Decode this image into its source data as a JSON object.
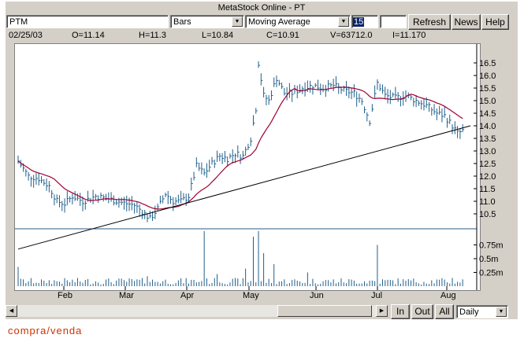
{
  "window": {
    "title": "MetaStock Online - PT"
  },
  "toolbar": {
    "symbol": "PTM",
    "chart_style": "Bars",
    "indicator": "Moving Average",
    "period": "15",
    "extra_value": "",
    "refresh_label": "Refresh",
    "news_label": "News",
    "help_label": "Help"
  },
  "stats": {
    "date": "02/25/03",
    "open": "O=11.14",
    "high": "H=11.3",
    "low": "L=10.84",
    "close": "C=10.91",
    "volume": "V=63712.0",
    "indicator": "I=11.170"
  },
  "bottom": {
    "in_label": "In",
    "out_label": "Out",
    "all_label": "All",
    "interval": "Daily"
  },
  "footer": {
    "text": "compra/venda"
  },
  "colors": {
    "bars": "#1f5f8b",
    "moving_average": "#a00030",
    "trendline": "#000000",
    "volume": "#1f5f8b"
  },
  "chart_data": {
    "type": "bar",
    "title": "",
    "price_axis": {
      "ticks": [
        "16.5",
        "16.0",
        "15.5",
        "15.0",
        "14.5",
        "14.0",
        "13.5",
        "13.0",
        "12.5",
        "12.0",
        "11.5",
        "11.0",
        "10.5"
      ],
      "range": [
        10.0,
        17.0
      ]
    },
    "volume_axis": {
      "ticks": [
        "0.75m",
        "0.5m",
        "0.25m"
      ],
      "range": [
        0,
        1.0
      ]
    },
    "x_labels": [
      "Feb",
      "Mar",
      "Apr",
      "May",
      "Jun",
      "Jul",
      "Aug"
    ],
    "price_path": [
      {
        "t": 0,
        "v": 12.6
      },
      {
        "t": 4,
        "v": 12.0
      },
      {
        "t": 8,
        "v": 11.9
      },
      {
        "t": 12,
        "v": 11.6
      },
      {
        "t": 15,
        "v": 11.0
      },
      {
        "t": 18,
        "v": 10.9
      },
      {
        "t": 21,
        "v": 11.2
      },
      {
        "t": 25,
        "v": 11.0
      },
      {
        "t": 30,
        "v": 11.2
      },
      {
        "t": 35,
        "v": 11.1
      },
      {
        "t": 40,
        "v": 10.95
      },
      {
        "t": 45,
        "v": 10.85
      },
      {
        "t": 48,
        "v": 10.6
      },
      {
        "t": 51,
        "v": 10.3
      },
      {
        "t": 54,
        "v": 10.7
      },
      {
        "t": 57,
        "v": 11.3
      },
      {
        "t": 60,
        "v": 11.0
      },
      {
        "t": 63,
        "v": 11.0
      },
      {
        "t": 66,
        "v": 11.2
      },
      {
        "t": 69,
        "v": 12.4
      },
      {
        "t": 72,
        "v": 12.1
      },
      {
        "t": 75,
        "v": 12.5
      },
      {
        "t": 78,
        "v": 12.8
      },
      {
        "t": 81,
        "v": 12.7
      },
      {
        "t": 84,
        "v": 12.9
      },
      {
        "t": 87,
        "v": 12.8
      },
      {
        "t": 90,
        "v": 13.5
      },
      {
        "t": 92,
        "v": 14.7
      },
      {
        "t": 93,
        "v": 16.5
      },
      {
        "t": 95,
        "v": 15.2
      },
      {
        "t": 97,
        "v": 15.0
      },
      {
        "t": 100,
        "v": 15.9
      },
      {
        "t": 103,
        "v": 15.3
      },
      {
        "t": 106,
        "v": 15.3
      },
      {
        "t": 110,
        "v": 15.5
      },
      {
        "t": 114,
        "v": 15.6
      },
      {
        "t": 118,
        "v": 15.5
      },
      {
        "t": 122,
        "v": 15.6
      },
      {
        "t": 126,
        "v": 15.4
      },
      {
        "t": 130,
        "v": 15.3
      },
      {
        "t": 133,
        "v": 15.0
      },
      {
        "t": 136,
        "v": 14.2
      },
      {
        "t": 139,
        "v": 15.7
      },
      {
        "t": 142,
        "v": 15.2
      },
      {
        "t": 146,
        "v": 15.1
      },
      {
        "t": 150,
        "v": 15.2
      },
      {
        "t": 154,
        "v": 15.0
      },
      {
        "t": 158,
        "v": 14.8
      },
      {
        "t": 162,
        "v": 14.5
      },
      {
        "t": 165,
        "v": 14.4
      },
      {
        "t": 168,
        "v": 14.0
      },
      {
        "t": 170,
        "v": 13.7
      },
      {
        "t": 172,
        "v": 13.8
      }
    ],
    "volume_spikes": [
      {
        "t": 0,
        "v": 0.35
      },
      {
        "t": 10,
        "v": 0.1
      },
      {
        "t": 50,
        "v": 0.18
      },
      {
        "t": 72,
        "v": 1.0
      },
      {
        "t": 77,
        "v": 0.22
      },
      {
        "t": 88,
        "v": 0.32
      },
      {
        "t": 91,
        "v": 0.9
      },
      {
        "t": 93,
        "v": 1.0
      },
      {
        "t": 95,
        "v": 0.6
      },
      {
        "t": 99,
        "v": 0.4
      },
      {
        "t": 112,
        "v": 0.25
      },
      {
        "t": 139,
        "v": 0.75
      },
      {
        "t": 150,
        "v": 0.1
      },
      {
        "t": 168,
        "v": 0.15
      }
    ],
    "trendline": {
      "start": {
        "t": 0,
        "v": 9.1
      },
      "end": {
        "t": 175,
        "v": 14.0
      }
    },
    "moving_average": {
      "period": 15
    },
    "grid": false,
    "legend": "none"
  }
}
